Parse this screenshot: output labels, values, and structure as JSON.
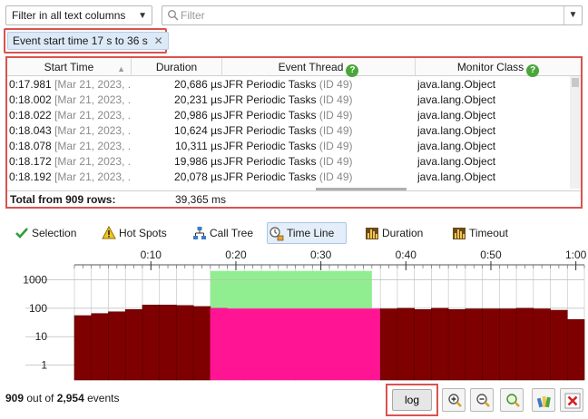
{
  "filter": {
    "column_select": "Filter in all text columns",
    "search_placeholder": "Filter",
    "chip_label": "Event start time 17 s to 36 s"
  },
  "table": {
    "columns": [
      "Start Time",
      "Duration",
      "Event Thread",
      "Monitor Class"
    ],
    "rows": [
      {
        "time": "0:17.981",
        "date": "[Mar 21, 2023, ...",
        "duration": "20,686 µs",
        "thread": "JFR Periodic Tasks",
        "thread_id": "(ID 49)",
        "monitor": "java.lang.Object"
      },
      {
        "time": "0:18.002",
        "date": "[Mar 21, 2023, ...",
        "duration": "20,231 µs",
        "thread": "JFR Periodic Tasks",
        "thread_id": "(ID 49)",
        "monitor": "java.lang.Object"
      },
      {
        "time": "0:18.022",
        "date": "[Mar 21, 2023, ...",
        "duration": "20,986 µs",
        "thread": "JFR Periodic Tasks",
        "thread_id": "(ID 49)",
        "monitor": "java.lang.Object"
      },
      {
        "time": "0:18.043",
        "date": "[Mar 21, 2023, ...",
        "duration": "10,624 µs",
        "thread": "JFR Periodic Tasks",
        "thread_id": "(ID 49)",
        "monitor": "java.lang.Object"
      },
      {
        "time": "0:18.078",
        "date": "[Mar 21, 2023, ...",
        "duration": "10,311 µs",
        "thread": "JFR Periodic Tasks",
        "thread_id": "(ID 49)",
        "monitor": "java.lang.Object"
      },
      {
        "time": "0:18.172",
        "date": "[Mar 21, 2023, ...",
        "duration": "19,986 µs",
        "thread": "JFR Periodic Tasks",
        "thread_id": "(ID 49)",
        "monitor": "java.lang.Object"
      },
      {
        "time": "0:18.192",
        "date": "[Mar 21, 2023, ...",
        "duration": "20,078 µs",
        "thread": "JFR Periodic Tasks",
        "thread_id": "(ID 49)",
        "monitor": "java.lang.Object"
      }
    ],
    "total_label": "Total from 909 rows:",
    "total_value": "39,365 ms"
  },
  "tabs": [
    {
      "label": "Selection",
      "icon": "check-icon"
    },
    {
      "label": "Hot Spots",
      "icon": "warning-icon"
    },
    {
      "label": "Call Tree",
      "icon": "tree-icon"
    },
    {
      "label": "Time Line",
      "icon": "timeline-icon",
      "active": true
    },
    {
      "label": "Duration",
      "icon": "histogram-icon"
    },
    {
      "label": "Timeout",
      "icon": "histogram-icon"
    }
  ],
  "chart_data": {
    "type": "bar",
    "x_ticks": [
      "0:10",
      "0:20",
      "0:30",
      "0:40",
      "0:50",
      "1:00"
    ],
    "x_tick_seconds": [
      10,
      20,
      30,
      40,
      50,
      60
    ],
    "x_range_seconds": [
      1,
      61
    ],
    "y_scale": "log",
    "y_ticks": [
      "1000",
      "100",
      "10",
      "1"
    ],
    "ylim": [
      0.3,
      2500
    ],
    "bin_seconds": 2,
    "bins_start_seconds": [
      1,
      3,
      5,
      7,
      9,
      11,
      13,
      15,
      17,
      19,
      21,
      23,
      25,
      27,
      29,
      31,
      33,
      35,
      37,
      39,
      41,
      43,
      45,
      47,
      49,
      51,
      53,
      55,
      57,
      59
    ],
    "values": [
      55,
      65,
      75,
      90,
      130,
      130,
      125,
      115,
      100,
      95,
      95,
      95,
      95,
      95,
      95,
      95,
      95,
      95,
      95,
      100,
      90,
      100,
      90,
      95,
      95,
      95,
      100,
      95,
      85,
      40
    ],
    "selection": {
      "from_seconds": 17,
      "to_seconds": 36,
      "selected_count": 909
    },
    "colors": {
      "bar": "#7f0000",
      "selected_bar": "#ff1493",
      "selection_band": "#90ee90"
    }
  },
  "footer": {
    "events_selected": "909",
    "events_middle": " out of ",
    "events_total": "2,954",
    "events_suffix": " events",
    "log_label": "log"
  }
}
